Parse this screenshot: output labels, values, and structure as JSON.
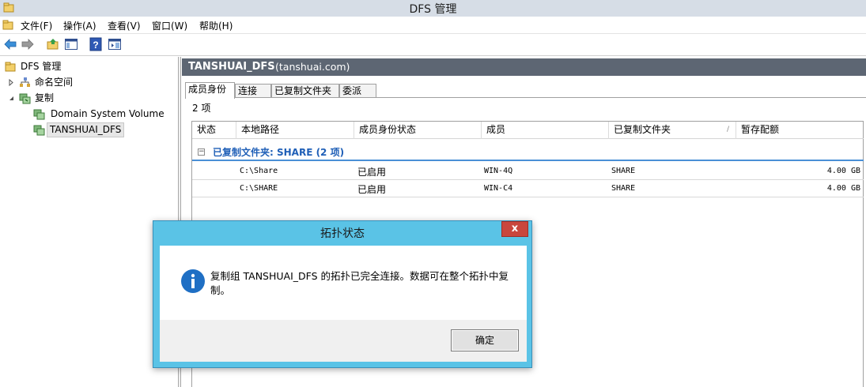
{
  "window": {
    "title": "DFS 管理"
  },
  "menu": {
    "items": [
      "文件(F)",
      "操作(A)",
      "查看(V)",
      "窗口(W)",
      "帮助(H)"
    ]
  },
  "toolbar": {
    "icons": [
      "back-arrow-icon",
      "forward-arrow-icon",
      "folder-up-icon",
      "show-hide-tree-icon",
      "help-icon",
      "action-pane-icon"
    ]
  },
  "tree": {
    "root": "DFS 管理",
    "namespaces": "命名空间",
    "replication": "复制",
    "children": [
      "Domain System Volume",
      "TANSHUAI_DFS"
    ]
  },
  "header": {
    "name": "TANSHUAI_DFS",
    "domain": "(tanshuai.com)"
  },
  "tabs": [
    "成员身份",
    "连接",
    "已复制文件夹",
    "委派"
  ],
  "count": "2 项",
  "columns": [
    "状态",
    "本地路径",
    "成员身份状态",
    "成员",
    "已复制文件夹",
    "暂存配额"
  ],
  "group": {
    "title": "已复制文件夹: SHARE (2 项)",
    "toggle": "−"
  },
  "rows": [
    {
      "status": "",
      "path": "C:\\Share",
      "state": "已启用",
      "member": "WIN-4Q",
      "folder": "SHARE",
      "quota": "4.00 GB"
    },
    {
      "status": "",
      "path": "C:\\SHARE",
      "state": "已启用",
      "member": "WIN-C4",
      "folder": "SHARE",
      "quota": "4.00 GB"
    }
  ],
  "dialog": {
    "title": "拓扑状态",
    "close": "x",
    "line1": "复制组 TANSHUAI_DFS 的拓扑已完全连接。数据可在整个拓扑中复",
    "line2": "制。",
    "ok": "确定"
  },
  "colors": {
    "header_bg": "#5d6673",
    "dialog_frame": "#5ac3e6",
    "close_btn": "#c9463d",
    "group_text": "#1f5fb7",
    "selection": "#e6e6e6"
  }
}
